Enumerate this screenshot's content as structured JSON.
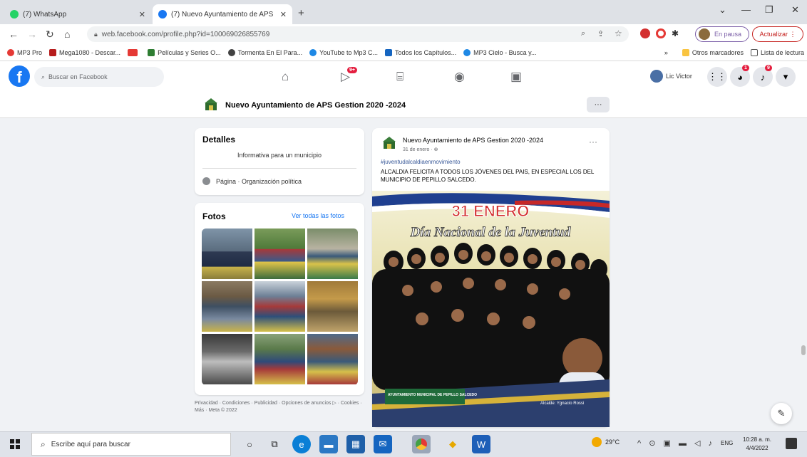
{
  "browser": {
    "tabs": [
      {
        "title": "(7) WhatsApp",
        "icon": "whatsapp-icon"
      },
      {
        "title": "(7) Nuevo Ayuntamiento de APS",
        "icon": "facebook-icon"
      }
    ],
    "url": "web.facebook.com/profile.php?id=100069026855769",
    "profile_label": "En pausa",
    "update_label": "Actualizar",
    "bookmarks": [
      {
        "label": "MP3 Pro",
        "color": "#e53935"
      },
      {
        "label": "Mega1080 - Descar...",
        "color": "#b71c1c"
      },
      {
        "label": "",
        "color": "#e53935"
      },
      {
        "label": "Películas y Series O...",
        "color": "#2e7d32"
      },
      {
        "label": "Tormenta En El Para...",
        "color": "#424242"
      },
      {
        "label": "YouTube to Mp3 C...",
        "color": "#1e88e5"
      },
      {
        "label": "Todos los Capítulos...",
        "color": "#1565c0"
      },
      {
        "label": "MP3 Cielo - Busca y...",
        "color": "#1e88e5"
      }
    ],
    "other_bookmarks": "Otros marcadores",
    "reading_list": "Lista de lectura"
  },
  "fb": {
    "search_placeholder": "Buscar en Facebook",
    "watch_badge": "9+",
    "user_name": "Lic Victor",
    "messenger_badge": "1",
    "notif_badge": "9"
  },
  "page": {
    "name": "Nuevo Ayuntamiento de APS Gestion 2020 -2024",
    "more": "···"
  },
  "details": {
    "title": "Detalles",
    "intro": "Informativa para un municipio",
    "category": "Página · Organización política"
  },
  "photos": {
    "title": "Fotos",
    "see_all": "Ver todas las fotos"
  },
  "footer": "Privacidad · Condiciones · Publicidad · Opciones de anuncios ▷ · Cookies · Más · Meta © 2022",
  "post": {
    "author": "Nuevo Ayuntamiento de APS Gestion 2020 -2024",
    "date": "31 de enero · ⊕",
    "hashtag": "#juventudalcaldiaenmovimiento",
    "text": "ALCALDIA FELICITA A TODOS LOS JÓVENES DEL PAIS, EN ESPECIAL LOS DEL MUNICIPIO DE PEPILLO SALCEDO.",
    "more": "···",
    "image_title": "31 ENERO",
    "image_subtitle": "Día Nacional de la Juventud",
    "image_footer_left": "AYUNTAMIENTO MUNICIPAL DE PEPILLO SALCEDO",
    "image_footer_right": "Alcalde: Ygnacio Rossi"
  },
  "taskbar": {
    "search_placeholder": "Escribe aquí para buscar",
    "weather": "29°C",
    "lang": "ENG",
    "time": "10:28 a. m.",
    "date": "4/4/2022"
  }
}
